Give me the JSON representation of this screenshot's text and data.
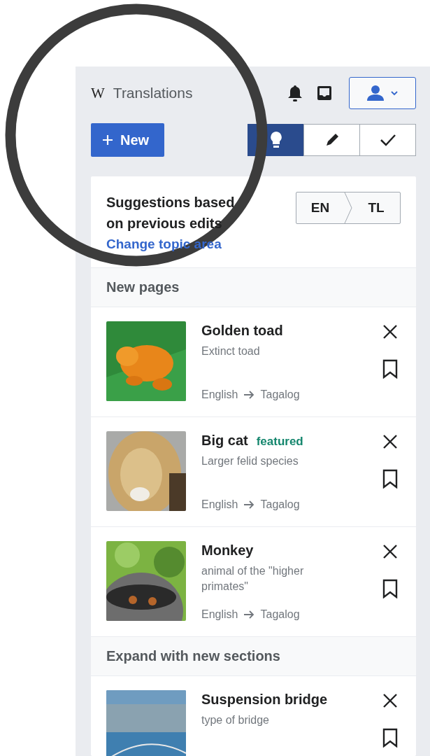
{
  "header": {
    "logo": "W",
    "title": "Translations"
  },
  "new_button": {
    "label": "New"
  },
  "modes": [
    {
      "kind": "suggestions",
      "selected": true
    },
    {
      "kind": "in-progress",
      "selected": false
    },
    {
      "kind": "published",
      "selected": false
    }
  ],
  "intro": {
    "title": "Suggestions based on previous edits",
    "link": "Change topic area",
    "source": "EN",
    "target": "TL"
  },
  "sections": [
    {
      "heading": "New pages",
      "items": [
        {
          "title": "Golden toad",
          "description": "Extinct toad",
          "from": "English",
          "to": "Tagalog"
        },
        {
          "title": "Big cat",
          "badge": "featured",
          "description": "Larger felid species",
          "from": "English",
          "to": "Tagalog"
        },
        {
          "title": "Monkey",
          "description": "animal of the \"higher primates\"",
          "from": "English",
          "to": "Tagalog"
        }
      ]
    },
    {
      "heading": "Expand with new sections",
      "items": [
        {
          "title": "Suspension bridge",
          "description": "type of bridge"
        }
      ]
    }
  ],
  "annotation": {
    "kind": "circle"
  }
}
